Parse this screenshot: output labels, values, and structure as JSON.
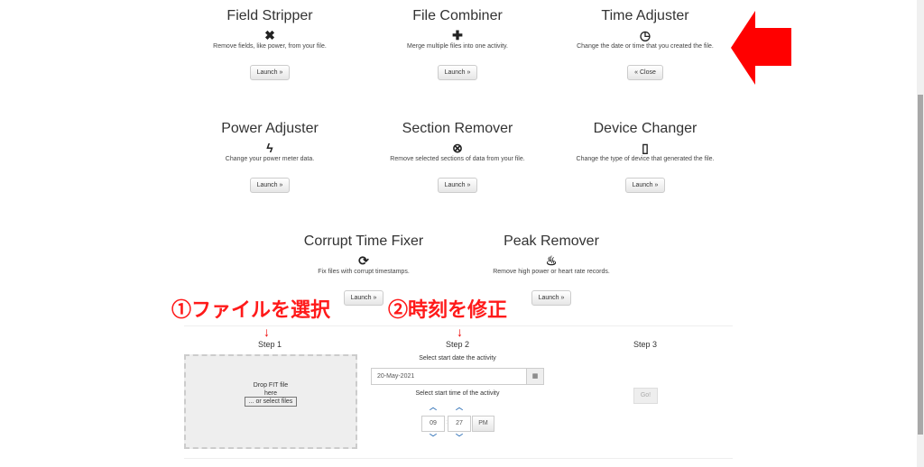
{
  "tools": [
    {
      "title": "Field Stripper",
      "icon": "✖",
      "icon_name": "times-icon",
      "desc": "Remove fields, like power, from your file.",
      "button": "Launch »"
    },
    {
      "title": "File Combiner",
      "icon": "✚",
      "icon_name": "plus-icon",
      "desc": "Merge multiple files into one activity.",
      "button": "Launch »"
    },
    {
      "title": "Time Adjuster",
      "icon": "◷",
      "icon_name": "clock-icon",
      "desc": "Change the date or time that you created the file.",
      "button": "« Close"
    },
    {
      "title": "Power Adjuster",
      "icon": "ϟ",
      "icon_name": "bolt-icon",
      "desc": "Change your power meter data.",
      "button": "Launch »"
    },
    {
      "title": "Section Remover",
      "icon": "⊗",
      "icon_name": "remove-circle-icon",
      "desc": "Remove selected sections of data from your file.",
      "button": "Launch »"
    },
    {
      "title": "Device Changer",
      "icon": "▯",
      "icon_name": "mobile-icon",
      "desc": "Change the type of device that generated the file.",
      "button": "Launch »"
    },
    {
      "title": "Corrupt Time Fixer",
      "icon": "⟳",
      "icon_name": "refresh-icon",
      "desc": "Fix files with corrupt timestamps.",
      "button": "Launch »"
    },
    {
      "title": "Peak Remover",
      "icon": "♨",
      "icon_name": "fire-icon",
      "desc": "Remove high power or heart rate records.",
      "button": "Launch »"
    }
  ],
  "steps": {
    "step1": "Step 1",
    "step2": "Step 2",
    "step3": "Step 3"
  },
  "drop": {
    "text1": "Drop FIT file",
    "text2": "here",
    "select": "... or select files"
  },
  "date": {
    "label": "Select start date the activity",
    "value": "20-May-2021",
    "icon": "calendar-icon"
  },
  "time": {
    "label": "Select start time of the activity",
    "hour": "09",
    "minute": "27",
    "ampm": "PM",
    "sep": ":"
  },
  "go": "Go!",
  "annotations": {
    "a1": "①ファイルを選択",
    "a2": "②時刻を修正",
    "arrow": "↓"
  },
  "colors": {
    "annotation": "#ff1a1a",
    "chevron": "#2a6db5"
  }
}
